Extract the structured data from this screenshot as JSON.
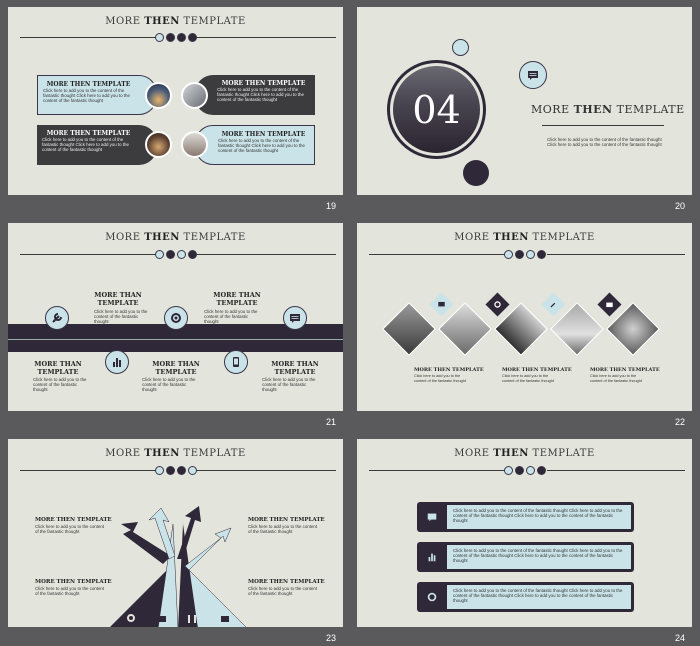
{
  "brand": {
    "dark": "#2e2838",
    "light": "#c9e3e8",
    "bg": "#e3e5dc"
  },
  "title": {
    "pre": "MORE ",
    "bold": "THEN",
    "post": " TEMPLATE"
  },
  "lorem1": "Click here to add you to the content of the fantastic thought",
  "lorem2": "Click here to add you to the content of the fantastic thought Click here to add you to the content of the fantastic thought",
  "lorem3": "Click here to add you to the content of the fantastic thought Click here to add you to the content of the fantastic thought Click here to add you to the content of the fantastic thought",
  "lorem_s": "Click here to add you to the content of the fantastic thought",
  "s19": {
    "num": "19",
    "head": "MORE THEN TEMPLATE"
  },
  "s20": {
    "num": "20",
    "big": "04",
    "title": "MORE THEN TEMPLATE"
  },
  "s21": {
    "num": "21",
    "head": "MORE THAN TEMPLATE"
  },
  "s22": {
    "num": "22",
    "head": "MORE THEN TEMPLATE"
  },
  "s23": {
    "num": "23",
    "head": "MORE THEN TEMPLATE"
  },
  "s24": {
    "num": "24"
  },
  "icons": [
    "chat-icon",
    "wrench-icon",
    "chart-icon",
    "gear-icon",
    "phone-icon",
    "briefcase-icon"
  ]
}
